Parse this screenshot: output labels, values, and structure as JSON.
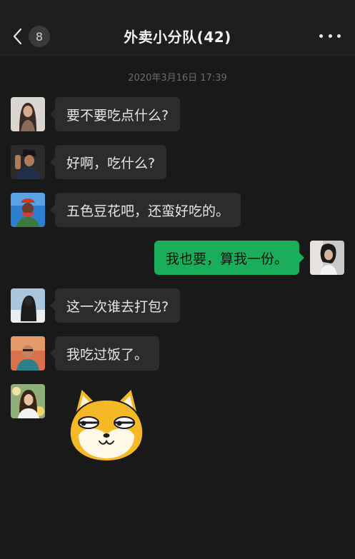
{
  "header": {
    "back_icon": "chevron-left-icon",
    "unread_count": "8",
    "title": "外卖小分队(42)",
    "more_icon": "more-dots-icon"
  },
  "timestamp": "2020年3月16日 17:39",
  "messages": [
    {
      "side": "left",
      "text": "要不要吃点什么?"
    },
    {
      "side": "left",
      "text": "好啊，吃什么?"
    },
    {
      "side": "left",
      "text": "五色豆花吧，还蛮好吃的。"
    },
    {
      "side": "right",
      "text": "我也要，算我一份。"
    },
    {
      "side": "left",
      "text": "这一次谁去打包?"
    },
    {
      "side": "left",
      "text": "我吃过饭了。"
    },
    {
      "side": "left",
      "sticker": "shiba-dog-sticker"
    }
  ],
  "colors": {
    "background": "#191919",
    "incoming_bubble": "#2c2c2c",
    "outgoing_bubble": "#1aad5a"
  }
}
